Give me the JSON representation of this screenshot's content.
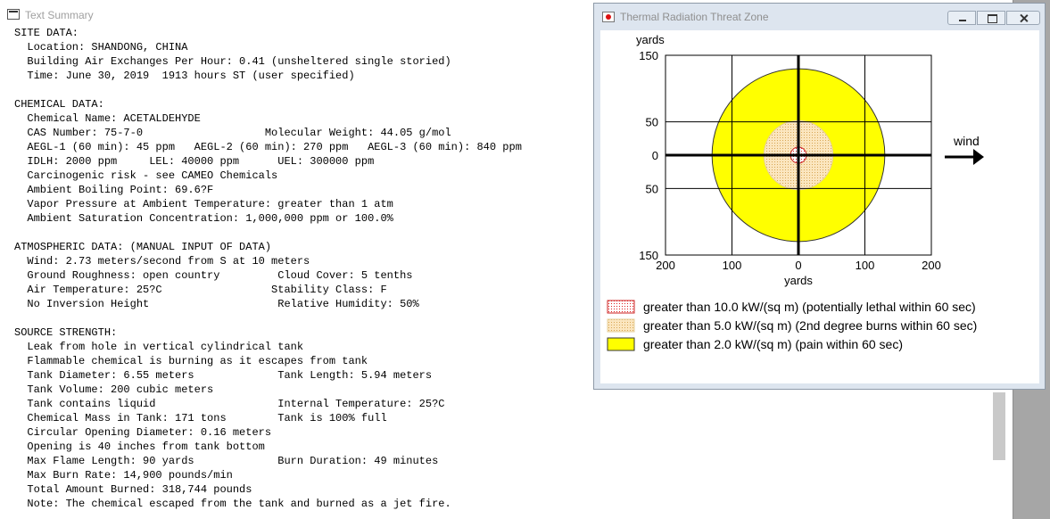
{
  "text_summary": {
    "title": "Text Summary",
    "lines": [
      "SITE DATA:",
      "  Location: SHANDONG, CHINA",
      "  Building Air Exchanges Per Hour: 0.41 (unsheltered single storied)",
      "  Time: June 30, 2019  1913 hours ST (user specified)",
      "",
      "CHEMICAL DATA:",
      "  Chemical Name: ACETALDEHYDE",
      "  CAS Number: 75-7-0                   Molecular Weight: 44.05 g/mol",
      "  AEGL-1 (60 min): 45 ppm   AEGL-2 (60 min): 270 ppm   AEGL-3 (60 min): 840 ppm",
      "  IDLH: 2000 ppm     LEL: 40000 ppm      UEL: 300000 ppm",
      "  Carcinogenic risk - see CAMEO Chemicals",
      "  Ambient Boiling Point: 69.6?F",
      "  Vapor Pressure at Ambient Temperature: greater than 1 atm",
      "  Ambient Saturation Concentration: 1,000,000 ppm or 100.0%",
      "",
      "ATMOSPHERIC DATA: (MANUAL INPUT OF DATA)",
      "  Wind: 2.73 meters/second from S at 10 meters",
      "  Ground Roughness: open country         Cloud Cover: 5 tenths",
      "  Air Temperature: 25?C                 Stability Class: F",
      "  No Inversion Height                    Relative Humidity: 50%",
      "",
      "SOURCE STRENGTH:",
      "  Leak from hole in vertical cylindrical tank",
      "  Flammable chemical is burning as it escapes from tank",
      "  Tank Diameter: 6.55 meters             Tank Length: 5.94 meters",
      "  Tank Volume: 200 cubic meters",
      "  Tank contains liquid                   Internal Temperature: 25?C",
      "  Chemical Mass in Tank: 171 tons        Tank is 100% full",
      "  Circular Opening Diameter: 0.16 meters",
      "  Opening is 40 inches from tank bottom",
      "  Max Flame Length: 90 yards             Burn Duration: 49 minutes",
      "  Max Burn Rate: 14,900 pounds/min",
      "  Total Amount Burned: 318,744 pounds",
      "  Note: The chemical escaped from the tank and burned as a jet fire."
    ]
  },
  "threat_zone": {
    "title": "Thermal Radiation Threat Zone",
    "wind_label": "wind",
    "chart_data": {
      "type": "threat-zone",
      "x_axis": {
        "label": "yards",
        "range": [
          -200,
          200
        ],
        "tick_values": [
          -200,
          -100,
          0,
          100,
          200
        ],
        "tick_labels": [
          "200",
          "100",
          "0",
          "100",
          "200"
        ]
      },
      "y_axis": {
        "label": "yards",
        "range": [
          -150,
          150
        ],
        "tick_values": [
          150,
          50,
          0,
          -50,
          -150
        ],
        "tick_labels": [
          "150",
          "50",
          "0",
          "50",
          "150"
        ]
      },
      "grid": true,
      "zones": [
        {
          "name": "red",
          "radius_yards": 12,
          "fill": "#ffffff",
          "pattern": "dots",
          "pattern_color": "#dd2222",
          "stroke": "#cc2222",
          "label": "greater than 10.0 kW/(sq m) (potentially lethal within 60 sec)"
        },
        {
          "name": "orange",
          "radius_yards": 52,
          "fill": "#fbe6bf",
          "pattern": "dots",
          "pattern_color": "#d8a655",
          "stroke": "#e6cf9a",
          "label": "greater than 5.0 kW/(sq m) (2nd degree burns within 60 sec)"
        },
        {
          "name": "yellow",
          "radius_yards": 130,
          "fill": "#ffff00",
          "pattern": "none",
          "pattern_color": "#ffff00",
          "stroke": "#333333",
          "label": "greater than 2.0 kW/(sq m) (pain within 60 sec)"
        }
      ]
    }
  }
}
